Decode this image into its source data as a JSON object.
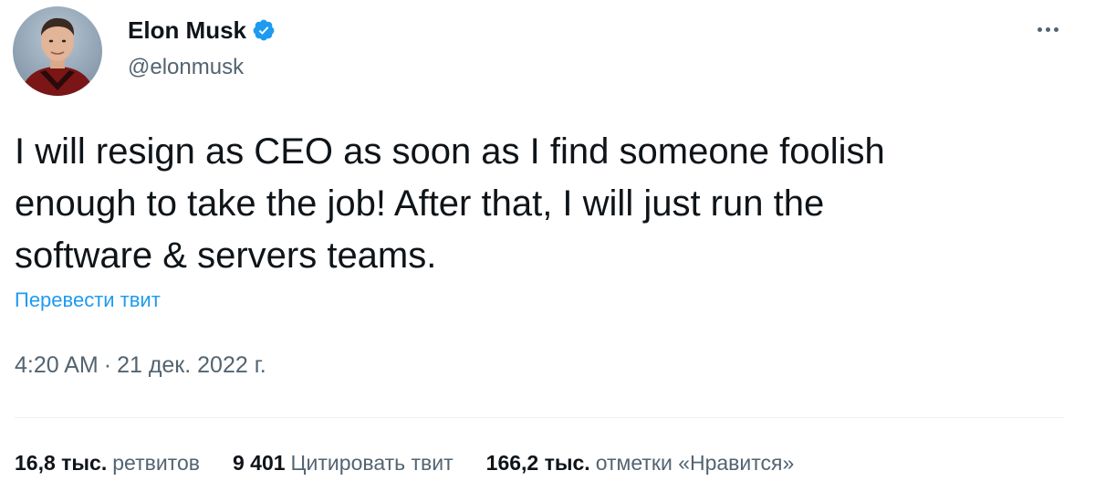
{
  "author": {
    "display_name": "Elon Musk",
    "handle": "@elonmusk",
    "avatar": "profile-photo",
    "verified_icon": "verified-badge-icon"
  },
  "tweet": {
    "text": "I will resign as CEO as soon as I find someone foolish\nenough to take the job! After that, I will just run the\nsoftware & servers teams.",
    "translate_label": "Перевести твит",
    "time": "4:20 AM",
    "separator": "·",
    "date": "21 дек. 2022 г."
  },
  "stats": {
    "retweets": {
      "count": "16,8 тыс.",
      "label": "ретвитов"
    },
    "quotes": {
      "count": "9 401",
      "label": "Цитировать твит"
    },
    "likes": {
      "count": "166,2 тыс.",
      "label": "отметки «Нравится»"
    }
  },
  "menu": {
    "icon": "more-options-icon"
  },
  "colors": {
    "accent": "#1d9bf0",
    "text_primary": "#0f1419",
    "text_secondary": "#536471",
    "divider": "#eff3f4"
  }
}
